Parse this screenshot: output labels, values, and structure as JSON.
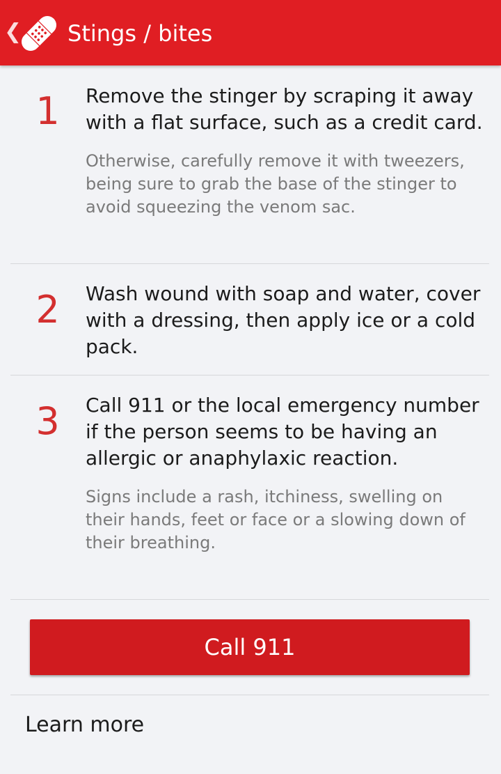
{
  "header": {
    "back_glyph": "❮",
    "title": "Stings / bites",
    "icon": "bandage-icon",
    "accent_color": "#e01e23"
  },
  "steps": [
    {
      "number": "1",
      "text": "Remove the stinger by scraping it away with a flat surface, such as a credit card.",
      "note": "Otherwise, carefully remove it with tweezers, being sure to grab the base of the stinger to avoid squeezing the venom sac."
    },
    {
      "number": "2",
      "text": "Wash wound with soap and water, cover with a dressing, then apply ice or a cold pack.",
      "note": ""
    },
    {
      "number": "3",
      "text": "Call 911 or the local emergency number if the person seems to be having an allergic or anaphylaxic reaction.",
      "note": "Signs include a rash, itchiness, swelling on their hands, feet or face or a slowing down of their breathing."
    }
  ],
  "call_button": {
    "label": "Call 911",
    "color": "#d01b1f"
  },
  "learn_more": {
    "label": "Learn more"
  },
  "colors": {
    "background": "#f2f3f6",
    "step_number": "#d32f2f",
    "note_text": "#7a7a7a",
    "divider": "#d6d7da"
  }
}
